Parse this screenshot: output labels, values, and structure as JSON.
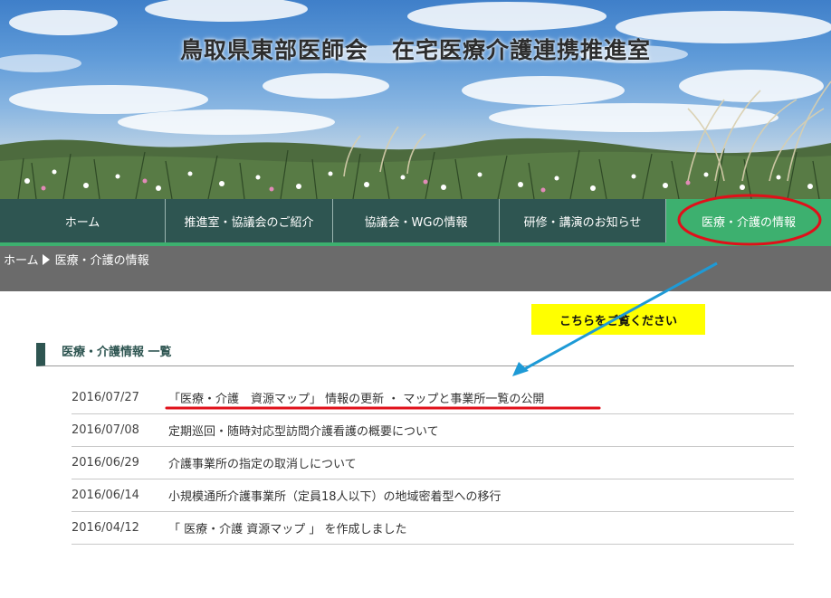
{
  "header": {
    "site_title": "鳥取県東部医師会　在宅医療介護連携推進室"
  },
  "nav": {
    "items": [
      {
        "label": "ホーム"
      },
      {
        "label": "推進室・協議会のご紹介"
      },
      {
        "label": "協議会・WGの情報"
      },
      {
        "label": "研修・講演のお知らせ"
      },
      {
        "label": "医療・介護の情報",
        "active": true
      }
    ]
  },
  "breadcrumb": {
    "home": "ホーム",
    "current": "医療・介護の情報"
  },
  "section": {
    "title": "医療・介護情報 一覧"
  },
  "news": [
    {
      "date": "2016/07/27",
      "title": "「医療・介護　資源マップ」 情報の更新 ・ マップと事業所一覧の公開"
    },
    {
      "date": "2016/07/08",
      "title": "定期巡回・随時対応型訪問介護看護の概要について"
    },
    {
      "date": "2016/06/29",
      "title": "介護事業所の指定の取消しについて"
    },
    {
      "date": "2016/06/14",
      "title": "小規模通所介護事業所（定員18人以下）の地域密着型への移行"
    },
    {
      "date": "2016/04/12",
      "title": "「 医療・介護 資源マップ 」 を作成しました"
    }
  ],
  "annotation": {
    "callout_text": "こちらをご覧ください",
    "mark_color": "#e0101a",
    "arrow_color": "#1e9ad6",
    "callout_color": "#ffff00"
  },
  "colors": {
    "nav_bg": "#2e5551",
    "nav_active": "#3db06f",
    "breadcrumb_bg": "#6b6b6b"
  }
}
